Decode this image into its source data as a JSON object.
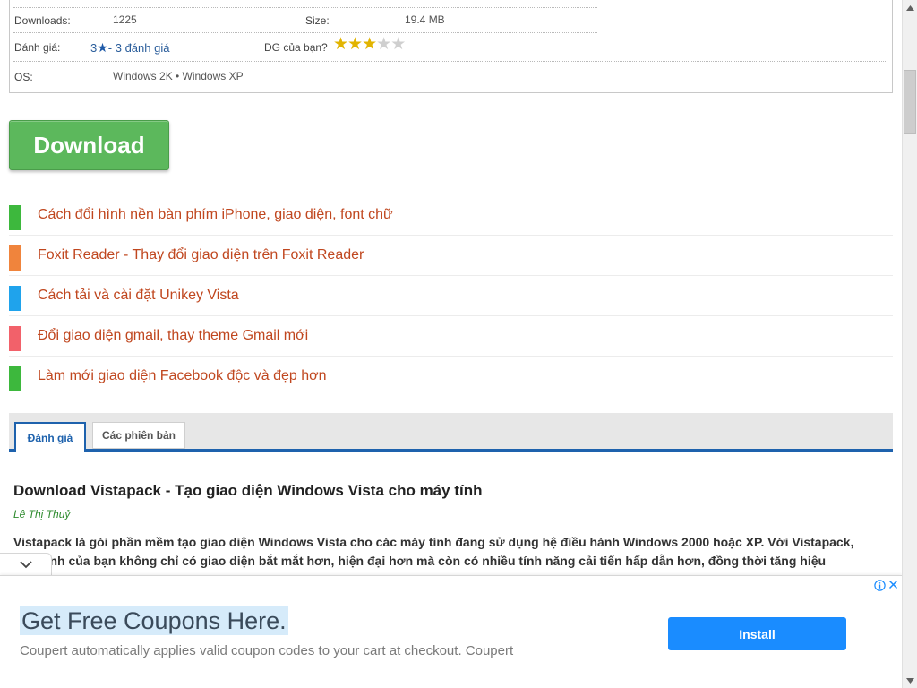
{
  "info": {
    "downloads_label": "Downloads:",
    "downloads_value": "1225",
    "size_label": "Size:",
    "size_value": "19.4 MB",
    "rating_label": "Đánh giá:",
    "rating_count": "3",
    "rating_star": "★",
    "rating_text": "- 3 đánh giá",
    "your_rating_label": "ĐG của bạn?",
    "your_rating": 3,
    "your_rating_max": 5,
    "os_label": "OS:",
    "os_value": "Windows 2K • Windows XP"
  },
  "download_button": "Download",
  "related": [
    {
      "text": "Cách đổi hình nền bàn phím iPhone, giao diện, font chữ",
      "color": "#3db83d"
    },
    {
      "text": "Foxit Reader - Thay đổi giao diện trên Foxit Reader",
      "color": "#f0843c"
    },
    {
      "text": "Cách tải và cài đặt Unikey Vista",
      "color": "#1fa3ec"
    },
    {
      "text": "Đổi giao diện gmail, thay theme Gmail mới",
      "color": "#f2616a"
    },
    {
      "text": "Làm mới giao diện Facebook độc và đẹp hơn",
      "color": "#3db83d"
    }
  ],
  "tabs": {
    "active": "Đánh giá",
    "inactive": "Các phiên bản"
  },
  "article": {
    "title": "Download Vistapack - Tạo giao diện Windows Vista cho máy tính",
    "author": "Lê Thị Thuỷ",
    "body_line1": "Vistapack là gói phần mềm tạo giao diện Windows Vista cho các máy tính đang sử dụng hệ điều hành Windows 2000 hoặc XP. Với Vistapack,",
    "body_line2": "máy tính của bạn không chỉ có giao diện bắt mắt hơn, hiện đại hơn mà còn có nhiều tính năng cải tiến hấp dẫn hơn, đồng thời tăng hiệu"
  },
  "ad": {
    "title": "Get Free Coupons Here.",
    "description": "Coupert automatically applies valid coupon codes to your cart at checkout. Coupert",
    "button": "Install"
  },
  "colors": {
    "download_green": "#5cb85c",
    "tab_blue": "#1e62ad",
    "link_orange": "#c0471f",
    "install_blue": "#1a8cff"
  },
  "icons": [
    "star-icon",
    "chevron-down-icon",
    "ad-info-icon",
    "ad-close-icon",
    "scroll-up-icon",
    "scroll-down-icon"
  ]
}
